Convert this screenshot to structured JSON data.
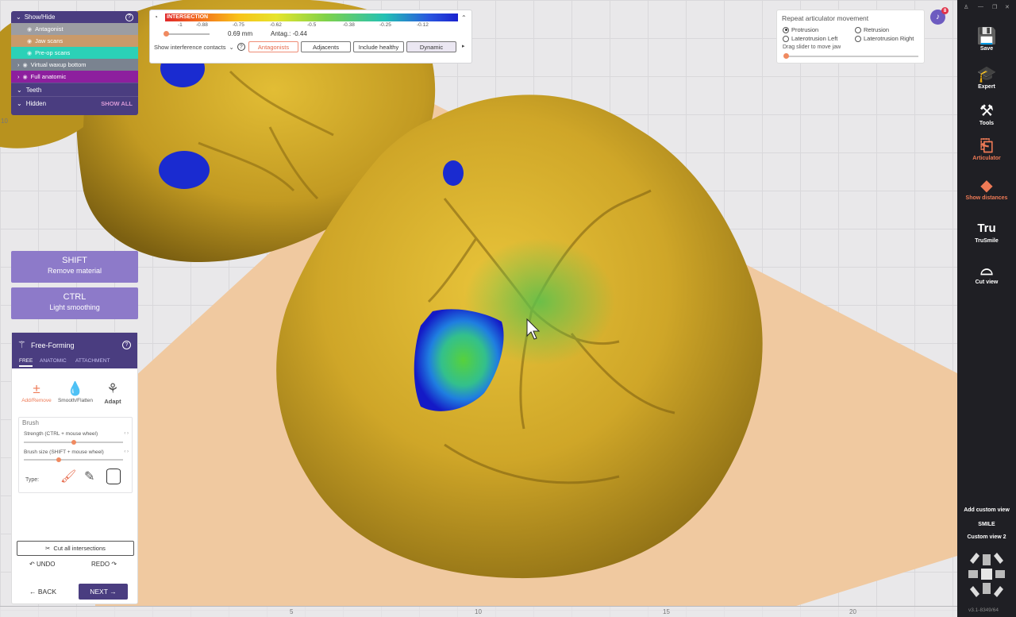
{
  "colors": {
    "accent": "#4a3d80",
    "orange": "#ee7a56",
    "tooth": "#c9a424",
    "background_plane": "#f0c9a0"
  },
  "show_hide": {
    "title": "Show/Hide",
    "layers": [
      {
        "label": "Antagonist",
        "color": "#9c9da2"
      },
      {
        "label": "Jaw scans",
        "color": "#c99a6a"
      },
      {
        "label": "Pre-op scans",
        "color": "#2bd1b7"
      },
      {
        "label": "Virtual waxup bottom",
        "color": "#7a8390"
      },
      {
        "label": "Full anatomic",
        "color": "#8d1f9e"
      }
    ],
    "teeth": "Teeth",
    "hidden": "Hidden",
    "show_all": "SHOW ALL"
  },
  "intersection": {
    "label": "INTERSECTION",
    "ticks": [
      "-1",
      "-0.88",
      "-0.75",
      "-0.62",
      "-0.5",
      "-0.38",
      "-0.25",
      "-0.12"
    ],
    "distance": "0.69 mm",
    "antag": "Antag.: -0.44",
    "show_contacts": "Show interference contacts",
    "chips": [
      "Antagonists",
      "Adjacents",
      "Include healthy",
      "Dynamic"
    ]
  },
  "articulator_panel": {
    "title": "Repeat articulator movement",
    "options": [
      {
        "label": "Protrusion",
        "checked": true
      },
      {
        "label": "Retrusion",
        "checked": false
      },
      {
        "label": "Laterotrusion Left",
        "checked": false
      },
      {
        "label": "Laterotrusion Right",
        "checked": false
      }
    ],
    "slider_hint": "Drag slider to move jaw"
  },
  "notification_count": "8",
  "shortcuts": [
    {
      "key": "SHIFT",
      "desc": "Remove material"
    },
    {
      "key": "CTRL",
      "desc": "Light smoothing"
    }
  ],
  "free_forming": {
    "title": "Free-Forming",
    "tabs": [
      "FREE",
      "ANATOMIC",
      "ATTACHMENT"
    ],
    "tools": [
      {
        "label": "Add/Remove",
        "icon": "add-remove-icon"
      },
      {
        "label": "Smooth/Flatten",
        "icon": "drop-icon"
      },
      {
        "label": "Adapt",
        "icon": "adapt-icon"
      }
    ],
    "brush": {
      "title": "Brush",
      "strength_label": "Strength (CTRL + mouse wheel)",
      "strength": 0.5,
      "size_label": "Brush size (SHIFT + mouse wheel)",
      "size": 0.35,
      "type_label": "Type:"
    },
    "cut_all": "Cut all intersections",
    "undo": "UNDO",
    "redo": "REDO",
    "back": "BACK",
    "next": "NEXT"
  },
  "toolbar": {
    "items": [
      {
        "label": "Save",
        "icon": "save-icon"
      },
      {
        "label": "Expert",
        "icon": "graduation-cap-icon"
      },
      {
        "label": "Tools",
        "icon": "tools-icon"
      },
      {
        "label": "Articulator",
        "icon": "articulator-icon",
        "active": true
      },
      {
        "label": "Show distances",
        "icon": "distances-icon",
        "active": true
      },
      {
        "label": "TruSmile",
        "icon": "trusmile-icon"
      },
      {
        "label": "Cut view",
        "icon": "cut-view-icon"
      }
    ],
    "custom_views": [
      "Add custom view",
      "SMILE",
      "Custom view 2"
    ],
    "version": "v3.1-8349/64"
  },
  "ruler": {
    "bottom": [
      "5",
      "10",
      "15",
      "20"
    ]
  }
}
